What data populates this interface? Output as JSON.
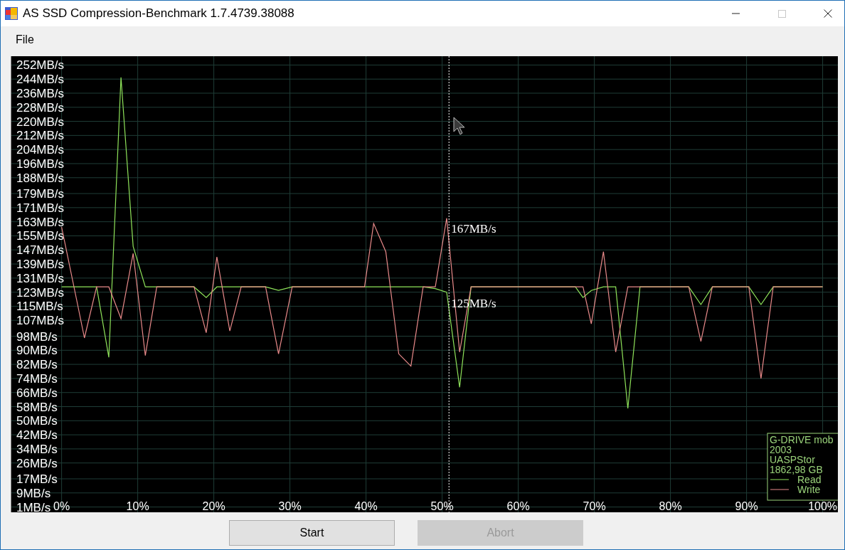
{
  "window": {
    "title": "AS SSD Compression-Benchmark 1.7.4739.38088",
    "controls": [
      {
        "kind": "minimize",
        "disabled": false
      },
      {
        "kind": "maximize",
        "disabled": true
      },
      {
        "kind": "close",
        "disabled": false
      }
    ]
  },
  "menu": [
    {
      "label": "File"
    }
  ],
  "plot": {
    "device_info": [
      "G-DRIVE mob",
      "2003",
      "UASPStor",
      "1862,98 GB"
    ],
    "chart_data": {
      "type": "line",
      "xlim": [
        -6.6,
        102
      ],
      "ylim": [
        -2,
        257
      ],
      "grid": true,
      "legend": true,
      "x": [
        0,
        2.1,
        3,
        4.6,
        6.2,
        7.8,
        9.4,
        11,
        12.5,
        17.4,
        19,
        20.4,
        22.1,
        23.6,
        26.8,
        28.5,
        30.3,
        39.8,
        41,
        42.6,
        44.3,
        45.9,
        47.5,
        49.1,
        50.6,
        52.3,
        53.8,
        67.5,
        68.5,
        69.6,
        71.2,
        72.8,
        74.4,
        76,
        82.4,
        84,
        85.5,
        90.3,
        91.9,
        93.5,
        100
      ],
      "series": [
        {
          "name": "Read",
          "color": "#8fe35a",
          "values": [
            126,
            126,
            126,
            126,
            86,
            245,
            149,
            126,
            126,
            126,
            120,
            126,
            126,
            126,
            126,
            124,
            126,
            126,
            126,
            126,
            126,
            126,
            126,
            125,
            123,
            69,
            126,
            126,
            120,
            124,
            126,
            126,
            57,
            126,
            126,
            116,
            126,
            126,
            116,
            126,
            126
          ]
        },
        {
          "name": "Write",
          "color": "#e98a8a",
          "values": [
            160,
            116,
            97,
            126,
            126,
            108,
            145,
            87,
            126,
            126,
            100,
            143,
            101,
            126,
            126,
            88,
            126,
            126,
            162,
            146,
            88,
            81,
            126,
            126,
            165,
            89,
            126,
            126,
            126,
            105,
            146,
            89,
            126,
            126,
            126,
            95,
            126,
            126,
            74,
            126,
            126
          ]
        }
      ],
      "xticks": [
        {
          "value": 0,
          "label": "0%"
        },
        {
          "value": 10,
          "label": "10%"
        },
        {
          "value": 20,
          "label": "20%"
        },
        {
          "value": 30,
          "label": "30%"
        },
        {
          "value": 40,
          "label": "40%"
        },
        {
          "value": 50,
          "label": "50%"
        },
        {
          "value": 60,
          "label": "60%"
        },
        {
          "value": 70,
          "label": "70%"
        },
        {
          "value": 80,
          "label": "80%"
        },
        {
          "value": 90,
          "label": "90%"
        },
        {
          "value": 100,
          "label": "100%"
        }
      ],
      "yticks": [
        {
          "value": 252,
          "label": "252MB/s"
        },
        {
          "value": 244,
          "label": "244MB/s"
        },
        {
          "value": 236,
          "label": "236MB/s"
        },
        {
          "value": 228,
          "label": "228MB/s"
        },
        {
          "value": 220,
          "label": "220MB/s"
        },
        {
          "value": 212,
          "label": "212MB/s"
        },
        {
          "value": 204,
          "label": "204MB/s"
        },
        {
          "value": 196,
          "label": "196MB/s"
        },
        {
          "value": 188,
          "label": "188MB/s"
        },
        {
          "value": 179,
          "label": "179MB/s"
        },
        {
          "value": 171,
          "label": "171MB/s"
        },
        {
          "value": 163,
          "label": "163MB/s"
        },
        {
          "value": 155,
          "label": "155MB/s"
        },
        {
          "value": 147,
          "label": "147MB/s"
        },
        {
          "value": 139,
          "label": "139MB/s"
        },
        {
          "value": 131,
          "label": "131MB/s"
        },
        {
          "value": 123,
          "label": "123MB/s"
        },
        {
          "value": 115,
          "label": "115MB/s"
        },
        {
          "value": 107,
          "label": "107MB/s"
        },
        {
          "value": 98,
          "label": "98MB/s"
        },
        {
          "value": 90,
          "label": "90MB/s"
        },
        {
          "value": 82,
          "label": "82MB/s"
        },
        {
          "value": 74,
          "label": "74MB/s"
        },
        {
          "value": 66,
          "label": "66MB/s"
        },
        {
          "value": 58,
          "label": "58MB/s"
        },
        {
          "value": 50,
          "label": "50MB/s"
        },
        {
          "value": 42,
          "label": "42MB/s"
        },
        {
          "value": 34,
          "label": "34MB/s"
        },
        {
          "value": 26,
          "label": "26MB/s"
        },
        {
          "value": 17,
          "label": "17MB/s"
        },
        {
          "value": 9,
          "label": "9MB/s"
        },
        {
          "value": 1,
          "label": "1MB/s"
        }
      ],
      "ref_lines": [
        {
          "axis": "x",
          "value": 50.9
        }
      ],
      "annotations": [
        "167MB/s",
        "125MB/s"
      ]
    }
  },
  "buttons": [
    {
      "label": "Start",
      "disabled": false
    },
    {
      "label": "Abort",
      "disabled": true
    }
  ]
}
